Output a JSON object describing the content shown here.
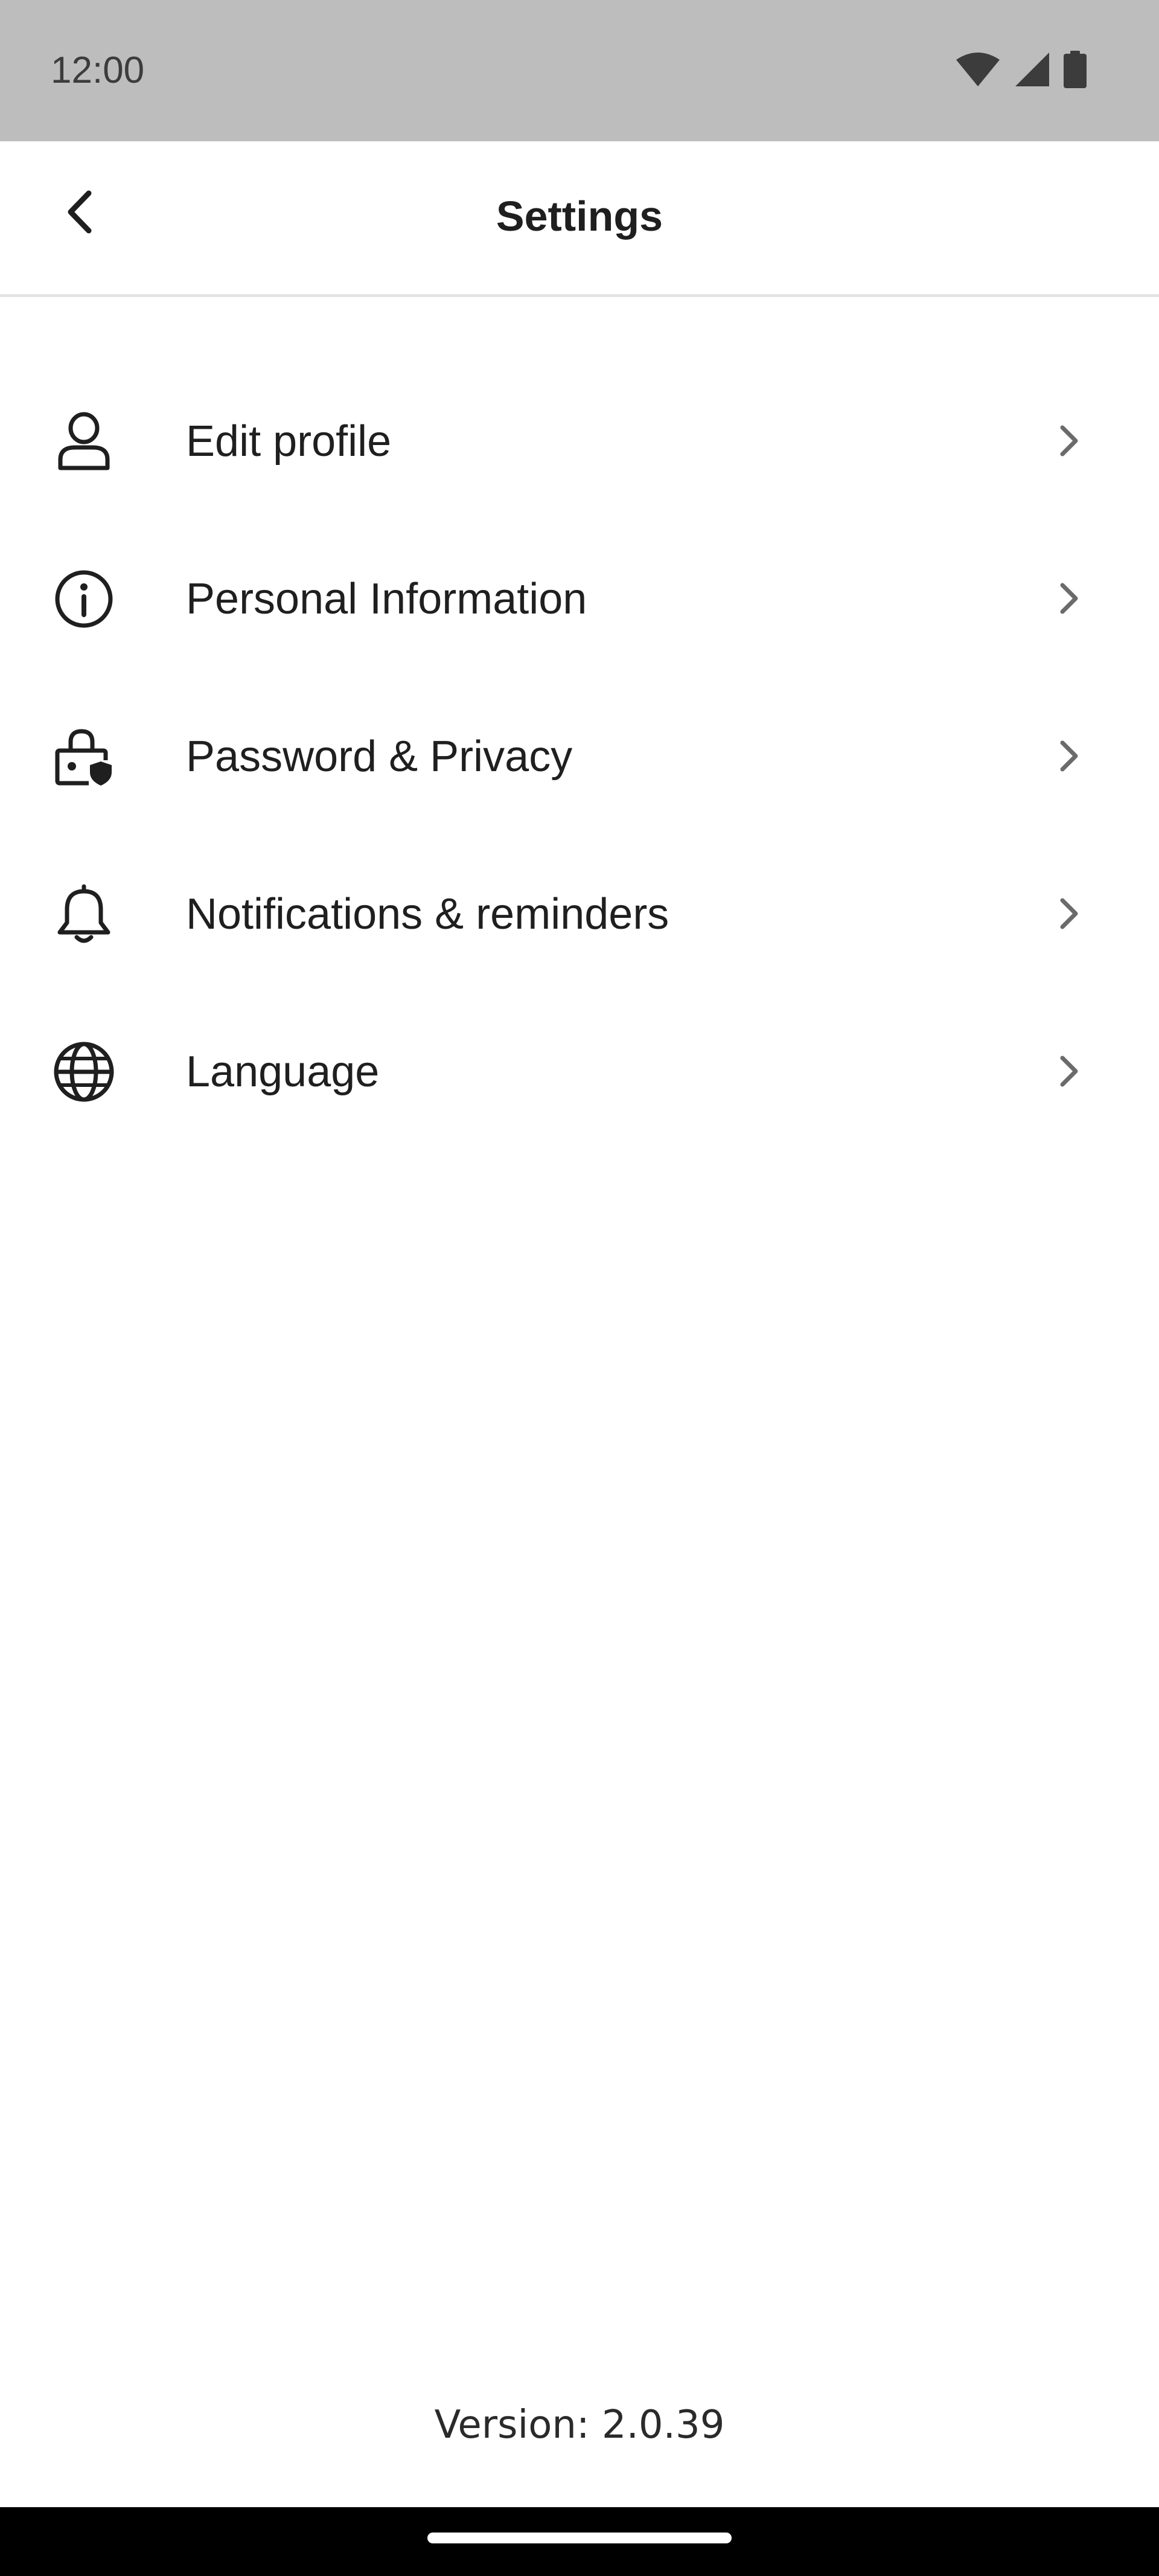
{
  "status_bar": {
    "time": "12:00",
    "icons": [
      "wifi-icon",
      "signal-icon",
      "battery-icon"
    ]
  },
  "app_bar": {
    "title": "Settings",
    "back_icon": "chevron-left-icon"
  },
  "menu": {
    "items": [
      {
        "label": "Edit profile",
        "icon": "user-icon"
      },
      {
        "label": "Personal Information",
        "icon": "info-icon"
      },
      {
        "label": "Password & Privacy",
        "icon": "lock-shield-icon"
      },
      {
        "label": "Notifications & reminders",
        "icon": "bell-icon"
      },
      {
        "label": "Language",
        "icon": "globe-icon"
      }
    ]
  },
  "footer": {
    "version": "Version: 2.0.39"
  },
  "colors": {
    "status_bar_bg": "#bdbdbd",
    "text": "#1f1f1f",
    "chevron": "#6b6b6b",
    "divider": "#e4e4e4",
    "nav_bar_bg": "#000000"
  }
}
